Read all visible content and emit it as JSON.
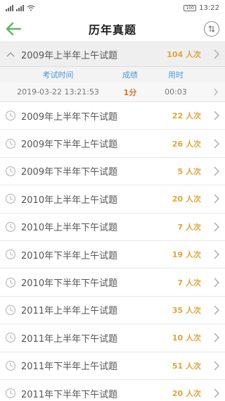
{
  "status_bar": {
    "time": "13:22",
    "battery": "100"
  },
  "header": {
    "title": "历年真题"
  },
  "expanded": {
    "name": "2009年上半年上午试题",
    "count": "104 人次",
    "columns": {
      "time": "考试时间",
      "score": "成绩",
      "used": "用时"
    },
    "record": {
      "time": "2019-03-22 13:21:53",
      "score": "1分",
      "used": "00:03"
    }
  },
  "exams": [
    {
      "name": "2009年上半年下午试题",
      "count": "22 人次"
    },
    {
      "name": "2009年下半年上午试题",
      "count": "26 人次"
    },
    {
      "name": "2009年下半年下午试题",
      "count": "5 人次"
    },
    {
      "name": "2010年上半年上午试题",
      "count": "20 人次"
    },
    {
      "name": "2010年上半年下午试题",
      "count": "7 人次"
    },
    {
      "name": "2010年下半年上午试题",
      "count": "19 人次"
    },
    {
      "name": "2010年下半年下午试题",
      "count": "7 人次"
    },
    {
      "name": "2011年上半年上午试题",
      "count": "35 人次"
    },
    {
      "name": "2011年上半年下午试题",
      "count": "10 人次"
    },
    {
      "name": "2011年下半年上午试题",
      "count": "51 人次"
    },
    {
      "name": "2011年下半年下午试题",
      "count": "20 人次"
    }
  ],
  "colors": {
    "accent_green": "#5cb85c",
    "count_orange": "#e0a43a",
    "header_blue": "#4a9bd6",
    "score_orange": "#e07020"
  }
}
